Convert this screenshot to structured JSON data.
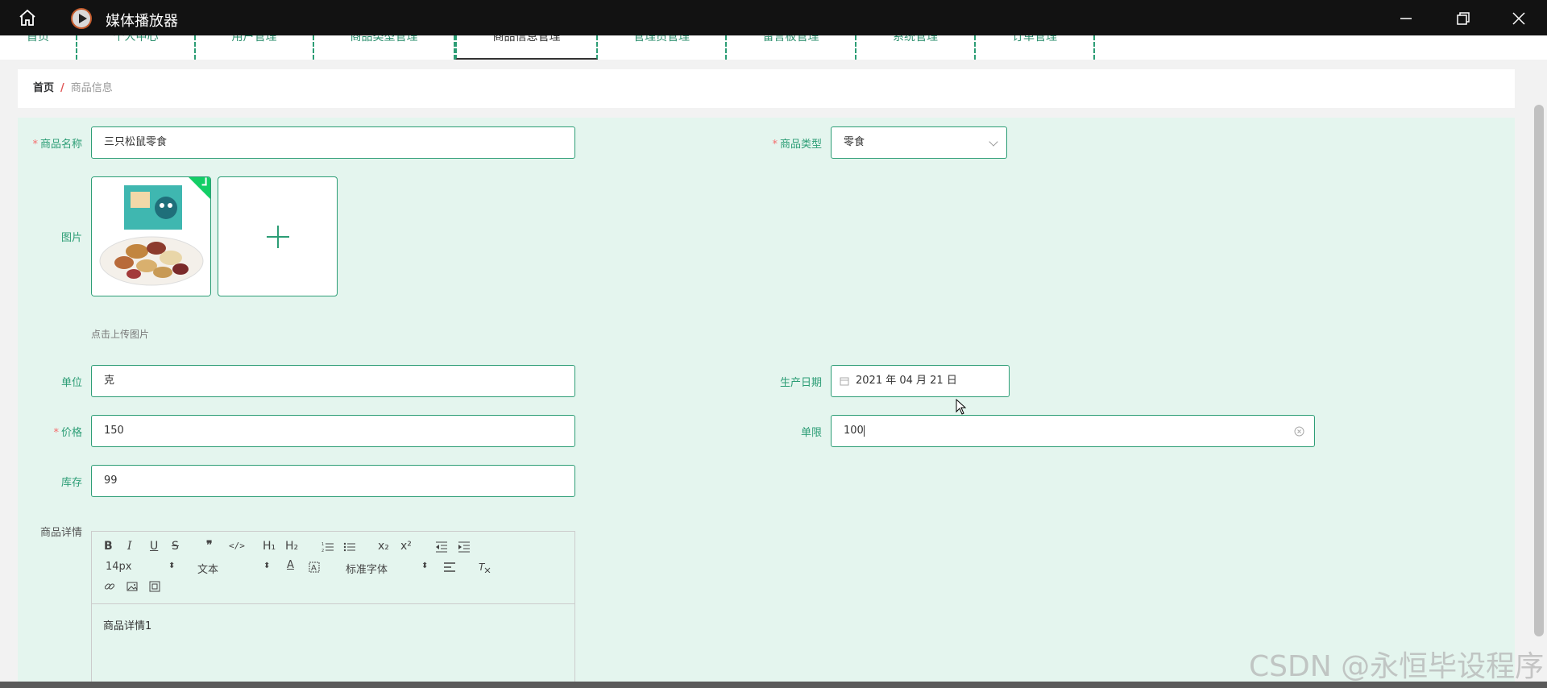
{
  "window": {
    "title": "媒体播放器",
    "icons": [
      "home-icon",
      "media-player-icon",
      "minimize-icon",
      "maximize-icon",
      "close-icon"
    ]
  },
  "topnav": {
    "items": [
      {
        "label": "首页"
      },
      {
        "label": "个人中心"
      },
      {
        "label": "用户管理"
      },
      {
        "label": "商品类型管理"
      },
      {
        "label": "商品信息管理"
      },
      {
        "label": "管理员管理"
      },
      {
        "label": "留言板管理"
      },
      {
        "label": "系统管理"
      },
      {
        "label": "订单管理"
      }
    ],
    "active": "商品信息管理"
  },
  "breadcrumb": {
    "home": "首页",
    "separator": "/",
    "current": "商品信息"
  },
  "form": {
    "name": {
      "label": "商品名称",
      "required": "*",
      "value": "三只松鼠零食"
    },
    "type": {
      "label": "商品类型",
      "required": "*",
      "value": "零食"
    },
    "image": {
      "label": "图片",
      "hint": "点击上传图片"
    },
    "unit": {
      "label": "单位",
      "value": "克"
    },
    "date": {
      "label": "生产日期",
      "value": "2021 年 04 月 21 日"
    },
    "price": {
      "label": "价格",
      "required": "*",
      "value": "150"
    },
    "limit": {
      "label": "单限",
      "value": "100"
    },
    "stock": {
      "label": "库存",
      "value": "99"
    },
    "detail": {
      "label": "商品详情",
      "content": "商品详情1",
      "toolbar": {
        "size": "14px",
        "text": "文本",
        "font": "标准字体",
        "buttons": [
          "B",
          "I",
          "U",
          "S",
          "❞",
          "</>",
          "H₁",
          "H₂",
          "x₂",
          "x²"
        ]
      }
    }
  },
  "watermark": "CSDN @永恒毕设程序",
  "colors": {
    "accent": "#2c9d75",
    "panel_bg": "#e4f5ee",
    "required": "#f56c6c",
    "check": "#13ce66",
    "titlebar": "#121212"
  }
}
